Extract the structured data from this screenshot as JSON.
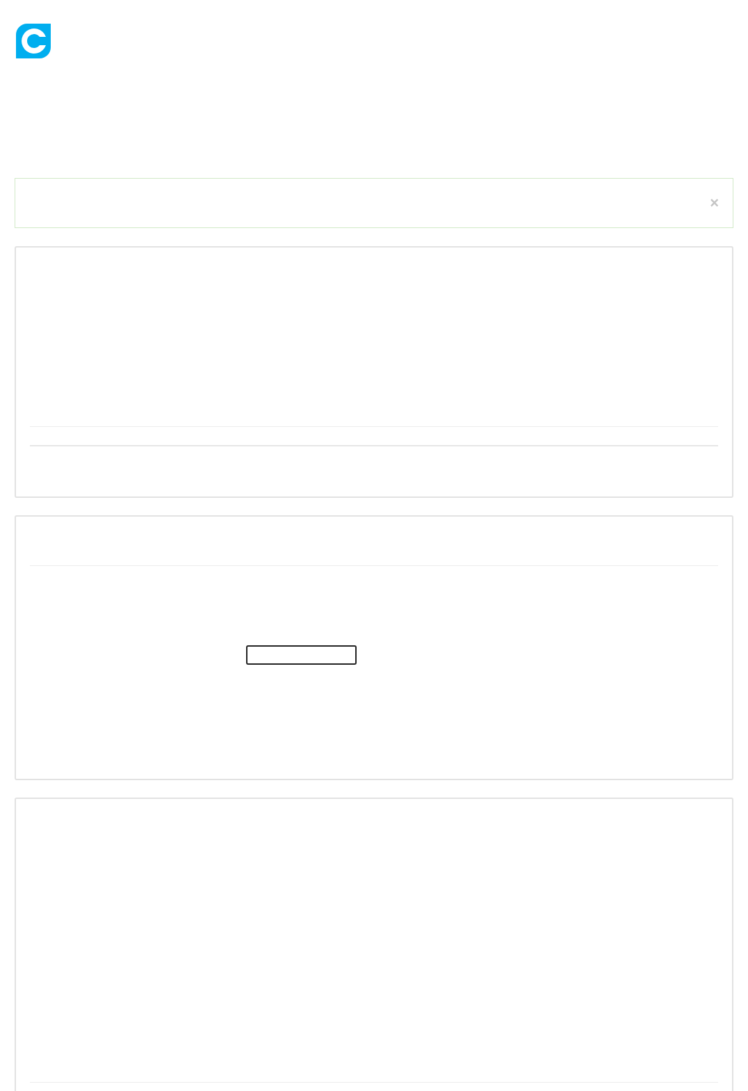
{
  "alert": {
    "close_label": "×"
  }
}
